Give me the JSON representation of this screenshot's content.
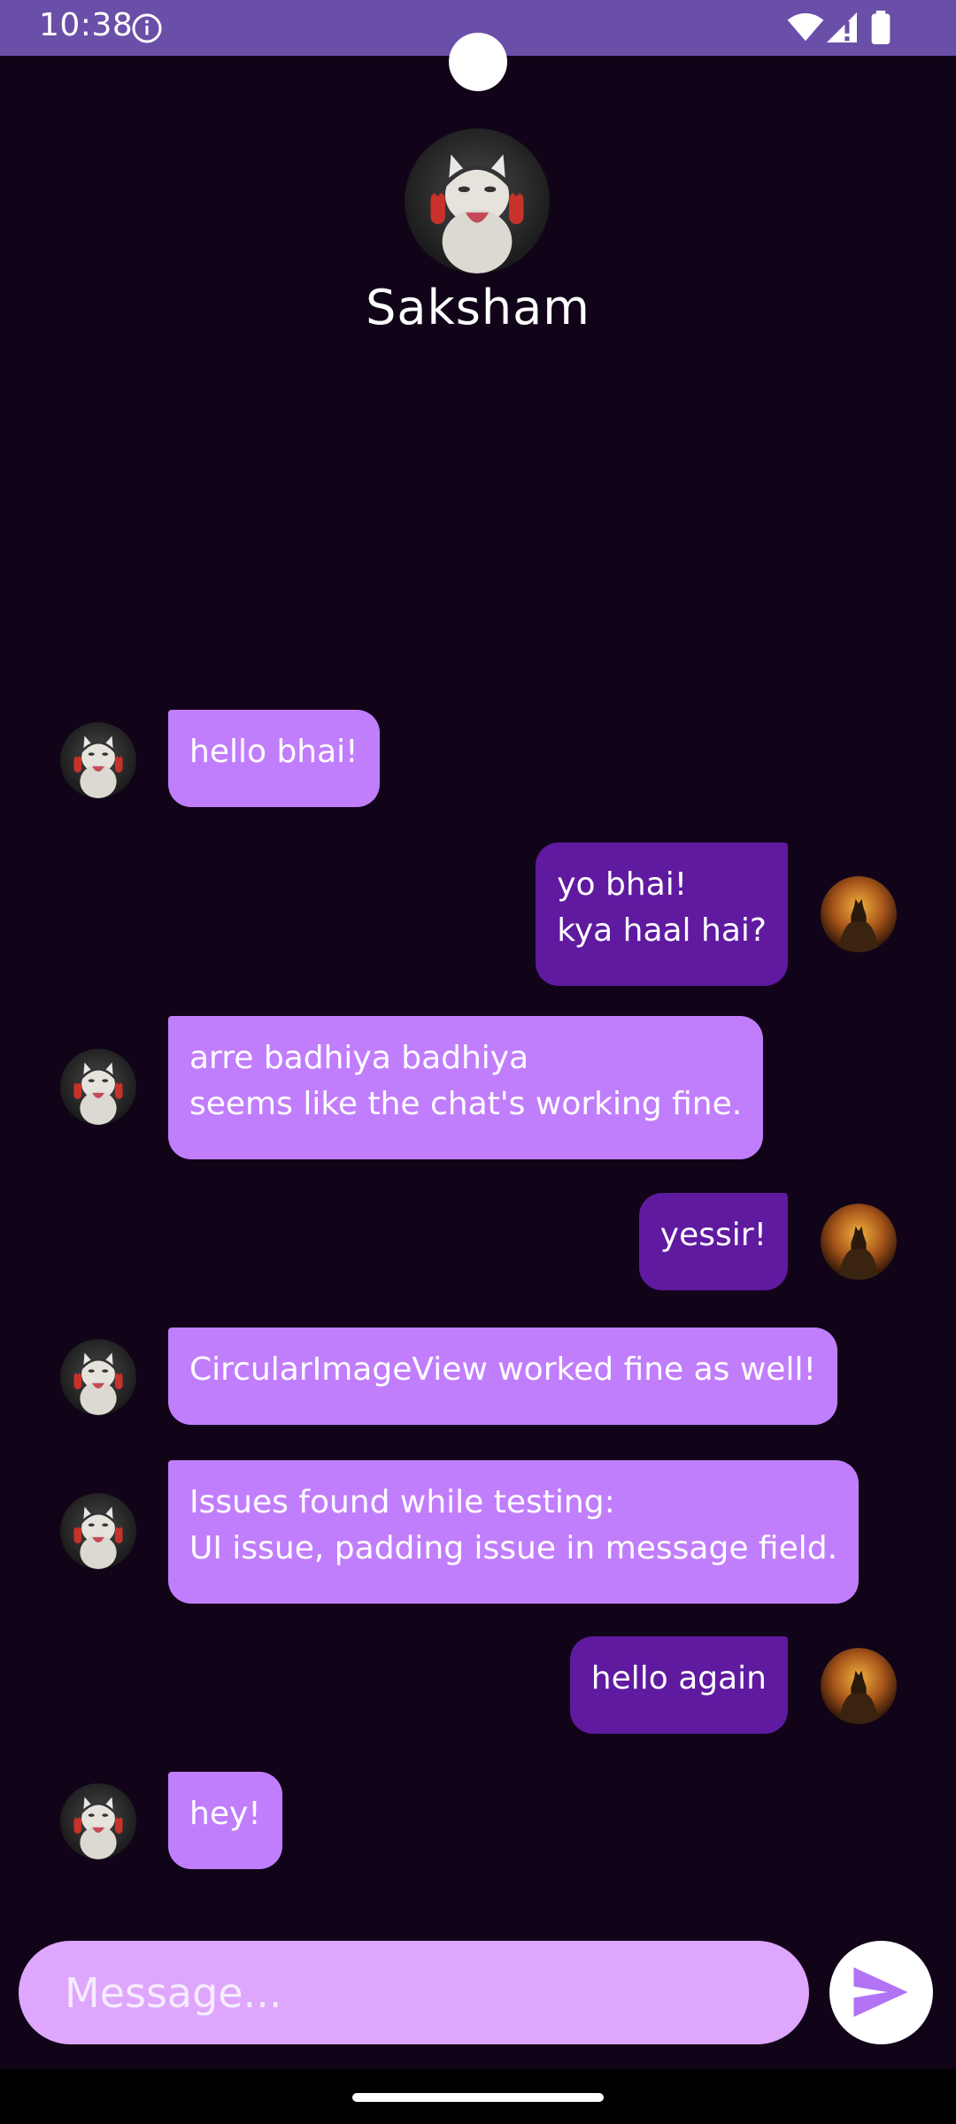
{
  "status_bar": {
    "time": "10:38",
    "icons": [
      "info-icon",
      "wifi-icon",
      "signal-icon",
      "battery-icon"
    ],
    "background": "#6a4fa8"
  },
  "header": {
    "contact_name": "Saksham",
    "avatar": "cat-with-headphones-avatar"
  },
  "messages": [
    {
      "direction": "received",
      "text": "hello bhai!",
      "avatar": "cat-avatar"
    },
    {
      "direction": "sent",
      "text": "yo bhai!\nkya haal hai?",
      "avatar": "batman-avatar"
    },
    {
      "direction": "received",
      "text": "arre badhiya badhiya\nseems like the chat's working fine.",
      "avatar": "cat-avatar"
    },
    {
      "direction": "sent",
      "text": "yessir!",
      "avatar": "batman-avatar"
    },
    {
      "direction": "received",
      "text": "CircularImageView worked fine as well!",
      "avatar": "cat-avatar"
    },
    {
      "direction": "received",
      "text": "Issues found while testing:\nUI issue, padding issue in message field.",
      "avatar": "cat-avatar"
    },
    {
      "direction": "sent",
      "text": "hello again",
      "avatar": "batman-avatar"
    },
    {
      "direction": "received",
      "text": "hey!",
      "avatar": "cat-avatar"
    }
  ],
  "composer": {
    "placeholder": "Message...",
    "value": "",
    "send_icon": "send-icon"
  },
  "colors": {
    "background": "#110419",
    "received_bubble": "#c17efc",
    "sent_bubble": "#5f1aa0",
    "input_background": "#dea6fc",
    "send_icon": "#b273f4"
  }
}
